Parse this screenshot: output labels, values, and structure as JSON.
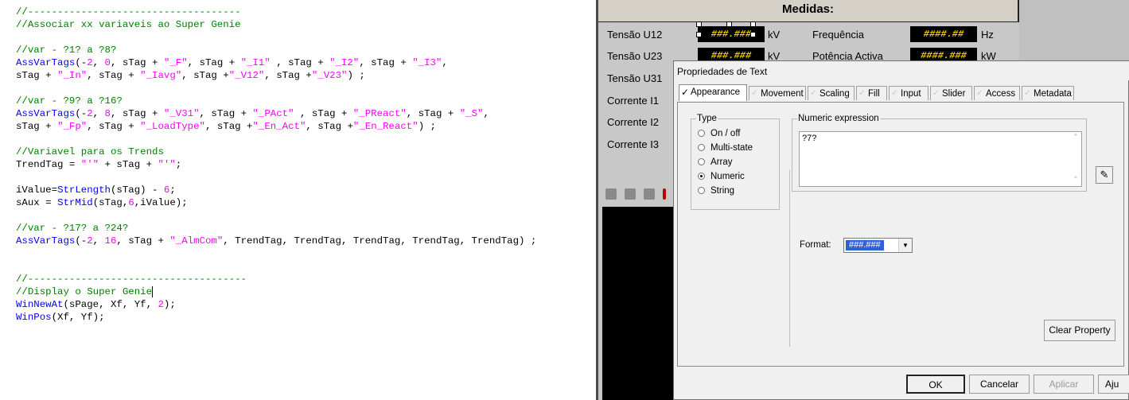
{
  "editor": {
    "lines": [
      [
        {
          "t": "//------------------------------------",
          "c": "g"
        }
      ],
      [
        {
          "t": "//Associar xx variaveis ao Super Genie",
          "c": "g"
        }
      ],
      [],
      [
        {
          "t": "//var - ?1? a ?8?",
          "c": "g"
        }
      ],
      [
        {
          "t": "AssVarTags",
          "c": "b"
        },
        {
          "t": "(-",
          "c": "r"
        },
        {
          "t": "2",
          "c": "m"
        },
        {
          "t": ", ",
          "c": "r"
        },
        {
          "t": "0",
          "c": "m"
        },
        {
          "t": ", sTag + ",
          "c": "r"
        },
        {
          "t": "\"_F\"",
          "c": "m"
        },
        {
          "t": ", sTag + ",
          "c": "r"
        },
        {
          "t": "\"_I1\"",
          "c": "m"
        },
        {
          "t": " , sTag + ",
          "c": "r"
        },
        {
          "t": "\"_I2\"",
          "c": "m"
        },
        {
          "t": ", sTag + ",
          "c": "r"
        },
        {
          "t": "\"_I3\"",
          "c": "m"
        },
        {
          "t": ",",
          "c": "r"
        }
      ],
      [
        {
          "t": "sTag + ",
          "c": "r"
        },
        {
          "t": "\"_In\"",
          "c": "m"
        },
        {
          "t": ", sTag + ",
          "c": "r"
        },
        {
          "t": "\"_Iavg\"",
          "c": "m"
        },
        {
          "t": ", sTag +",
          "c": "r"
        },
        {
          "t": "\"_V12\"",
          "c": "m"
        },
        {
          "t": ", sTag +",
          "c": "r"
        },
        {
          "t": "\"_V23\"",
          "c": "m"
        },
        {
          "t": ") ;",
          "c": "r"
        }
      ],
      [],
      [
        {
          "t": "//var - ?9? a ?16?",
          "c": "g"
        }
      ],
      [
        {
          "t": "AssVarTags",
          "c": "b"
        },
        {
          "t": "(-",
          "c": "r"
        },
        {
          "t": "2",
          "c": "m"
        },
        {
          "t": ", ",
          "c": "r"
        },
        {
          "t": "8",
          "c": "m"
        },
        {
          "t": ", sTag + ",
          "c": "r"
        },
        {
          "t": "\"_V31\"",
          "c": "m"
        },
        {
          "t": ", sTag + ",
          "c": "r"
        },
        {
          "t": "\"_PAct\"",
          "c": "m"
        },
        {
          "t": " , sTag + ",
          "c": "r"
        },
        {
          "t": "\"_PReact\"",
          "c": "m"
        },
        {
          "t": ", sTag + ",
          "c": "r"
        },
        {
          "t": "\"_S\"",
          "c": "m"
        },
        {
          "t": ",",
          "c": "r"
        }
      ],
      [
        {
          "t": "sTag + ",
          "c": "r"
        },
        {
          "t": "\"_Fp\"",
          "c": "m"
        },
        {
          "t": ", sTag + ",
          "c": "r"
        },
        {
          "t": "\"_LoadType\"",
          "c": "m"
        },
        {
          "t": ", sTag +",
          "c": "r"
        },
        {
          "t": "\"_En_Act\"",
          "c": "m"
        },
        {
          "t": ", sTag +",
          "c": "r"
        },
        {
          "t": "\"_En_React\"",
          "c": "m"
        },
        {
          "t": ") ;",
          "c": "r"
        }
      ],
      [],
      [
        {
          "t": "//Variavel para os Trends",
          "c": "g"
        }
      ],
      [
        {
          "t": "TrendTag = ",
          "c": "r"
        },
        {
          "t": "\"'\"",
          "c": "m"
        },
        {
          "t": " + sTag + ",
          "c": "r"
        },
        {
          "t": "\"'\"",
          "c": "m"
        },
        {
          "t": ";",
          "c": "r"
        }
      ],
      [],
      [
        {
          "t": "iValue=",
          "c": "r"
        },
        {
          "t": "StrLength",
          "c": "b"
        },
        {
          "t": "(sTag) - ",
          "c": "r"
        },
        {
          "t": "6",
          "c": "m"
        },
        {
          "t": ";",
          "c": "r"
        }
      ],
      [
        {
          "t": "sAux = ",
          "c": "r"
        },
        {
          "t": "StrMid",
          "c": "b"
        },
        {
          "t": "(sTag,",
          "c": "r"
        },
        {
          "t": "6",
          "c": "m"
        },
        {
          "t": ",iValue);",
          "c": "r"
        }
      ],
      [],
      [
        {
          "t": "//var - ?17? a ?24?",
          "c": "g"
        }
      ],
      [
        {
          "t": "AssVarTags",
          "c": "b"
        },
        {
          "t": "(-",
          "c": "r"
        },
        {
          "t": "2",
          "c": "m"
        },
        {
          "t": ", ",
          "c": "r"
        },
        {
          "t": "16",
          "c": "m"
        },
        {
          "t": ", sTag + ",
          "c": "r"
        },
        {
          "t": "\"_AlmCom\"",
          "c": "m"
        },
        {
          "t": ", TrendTag, TrendTag, TrendTag, TrendTag, TrendTag) ;",
          "c": "r"
        }
      ],
      [],
      [],
      [
        {
          "t": "//-------------------------------------",
          "c": "g"
        }
      ],
      [
        {
          "t": "//Display o Super Genie",
          "c": "g"
        },
        {
          "caret": true
        }
      ],
      [
        {
          "t": "WinNewAt",
          "c": "b"
        },
        {
          "t": "(sPage, Xf, Yf, ",
          "c": "r"
        },
        {
          "t": "2",
          "c": "m"
        },
        {
          "t": ");",
          "c": "r"
        }
      ],
      [
        {
          "t": "WinPos",
          "c": "b"
        },
        {
          "t": "(Xf, Yf);",
          "c": "r"
        }
      ]
    ]
  },
  "hmi": {
    "header": "Medidas:",
    "left_labels": [
      "Tensão U12",
      "Tensão U23",
      "Tensão U31",
      "Corrente I1",
      "Corrente I2",
      "Corrente I3"
    ],
    "row1": {
      "value": "###.###",
      "unit": "kV",
      "label2": "Frequência",
      "value2": "####.##",
      "unit2": "Hz"
    },
    "row2": {
      "value": "###.###",
      "unit": "kV",
      "label2": "Potência Activa",
      "value2": "####.###",
      "unit2": "kW"
    }
  },
  "dialog": {
    "title": "Propriedades de Text",
    "tabs": [
      "Appearance",
      "Movement",
      "Scaling",
      "Fill",
      "Input",
      "Slider",
      "Access",
      "Metadata"
    ],
    "active_tab": "Appearance",
    "type_group": {
      "label": "Type",
      "options": [
        "On / off",
        "Multi-state",
        "Array",
        "Numeric",
        "String"
      ],
      "selected": "Numeric"
    },
    "expression": {
      "label": "Numeric expression",
      "value": "?7?"
    },
    "format": {
      "label": "Format:",
      "value": "###.###"
    },
    "clear_button": "Clear Property",
    "buttons": {
      "ok": "OK",
      "cancel": "Cancelar",
      "apply": "Aplicar",
      "help": "Aju"
    }
  }
}
